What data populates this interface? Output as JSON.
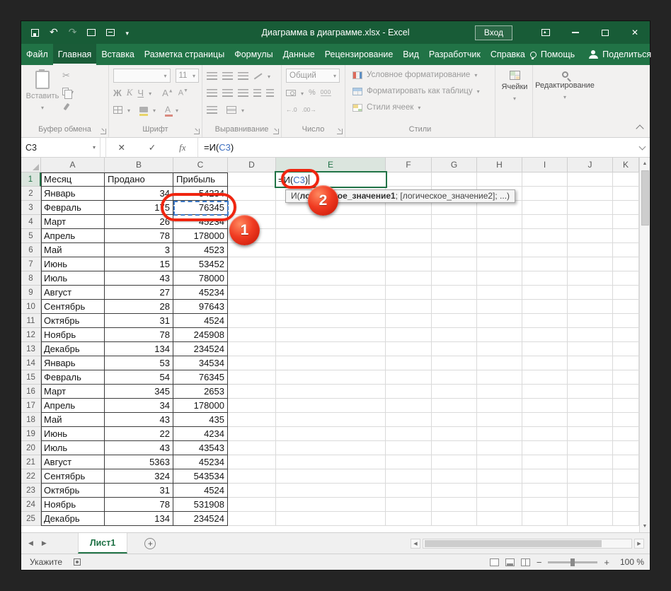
{
  "titlebar": {
    "title": "Диаграмма в диаграмме.xlsx - Excel",
    "signin": "Вход"
  },
  "tabs": {
    "items": [
      "Файл",
      "Главная",
      "Вставка",
      "Разметка страницы",
      "Формулы",
      "Данные",
      "Рецензирование",
      "Вид",
      "Разработчик",
      "Справка"
    ],
    "active": "Главная",
    "help": "Помощь",
    "share": "Поделиться"
  },
  "ribbon": {
    "clipboard": {
      "paste": "Вставить",
      "label": "Буфер обмена"
    },
    "font": {
      "size": "11",
      "bold": "Ж",
      "italic": "К",
      "underline": "Ч",
      "grow": "А",
      "shrink": "А",
      "color_letter": "А",
      "label": "Шрифт"
    },
    "alignment": {
      "label": "Выравнивание"
    },
    "number": {
      "format": "Общий",
      "percent": "%",
      "thousands": "000",
      "inc_dec": "←.0",
      "dec_dec": ".00→",
      "label": "Число"
    },
    "styles": {
      "items": [
        "Условное форматирование",
        "Форматировать как таблицу",
        "Стили ячеек"
      ],
      "label": "Стили"
    },
    "cells": {
      "label": "Ячейки"
    },
    "editing": {
      "label": "Редактирование"
    }
  },
  "formula_bar": {
    "name_box": "C3",
    "cancel": "✕",
    "enter": "✓",
    "fx": "fx",
    "formula": {
      "prefix": "=И(",
      "ref": "C3",
      "suffix": ")"
    }
  },
  "edit_cell": {
    "prefix": "=И(",
    "ref": "C3",
    "suffix": ")"
  },
  "tooltip": {
    "fn": "И(",
    "active_arg": "логическое_значение1",
    "rest": "; [логическое_значение2]; ...)"
  },
  "annotations": {
    "badge1": "1",
    "badge2": "2"
  },
  "grid": {
    "columns": [
      "A",
      "B",
      "C",
      "D",
      "E",
      "F",
      "G",
      "H",
      "I",
      "J",
      "K"
    ],
    "active_col": "E",
    "active_row": 1,
    "rows": [
      {
        "n": 1,
        "cells": [
          "Месяц",
          "Продано",
          "Прибыль"
        ]
      },
      {
        "n": 2,
        "cells": [
          "Январь",
          "34",
          "54234"
        ]
      },
      {
        "n": 3,
        "cells": [
          "Февраль",
          "175",
          "76345"
        ]
      },
      {
        "n": 4,
        "cells": [
          "Март",
          "26",
          "45234"
        ]
      },
      {
        "n": 5,
        "cells": [
          "Апрель",
          "78",
          "178000"
        ]
      },
      {
        "n": 6,
        "cells": [
          "Май",
          "3",
          "4523"
        ]
      },
      {
        "n": 7,
        "cells": [
          "Июнь",
          "15",
          "53452"
        ]
      },
      {
        "n": 8,
        "cells": [
          "Июль",
          "43",
          "78000"
        ]
      },
      {
        "n": 9,
        "cells": [
          "Август",
          "27",
          "45234"
        ]
      },
      {
        "n": 10,
        "cells": [
          "Сентябрь",
          "28",
          "97643"
        ]
      },
      {
        "n": 11,
        "cells": [
          "Октябрь",
          "31",
          "4524"
        ]
      },
      {
        "n": 12,
        "cells": [
          "Ноябрь",
          "78",
          "245908"
        ]
      },
      {
        "n": 13,
        "cells": [
          "Декабрь",
          "134",
          "234524"
        ]
      },
      {
        "n": 14,
        "cells": [
          "Январь",
          "53",
          "34534"
        ]
      },
      {
        "n": 15,
        "cells": [
          "Февраль",
          "54",
          "76345"
        ]
      },
      {
        "n": 16,
        "cells": [
          "Март",
          "345",
          "2653"
        ]
      },
      {
        "n": 17,
        "cells": [
          "Апрель",
          "34",
          "178000"
        ]
      },
      {
        "n": 18,
        "cells": [
          "Май",
          "43",
          "435"
        ]
      },
      {
        "n": 19,
        "cells": [
          "Июнь",
          "22",
          "4234"
        ]
      },
      {
        "n": 20,
        "cells": [
          "Июль",
          "43",
          "43543"
        ]
      },
      {
        "n": 21,
        "cells": [
          "Август",
          "5363",
          "45234"
        ]
      },
      {
        "n": 22,
        "cells": [
          "Сентябрь",
          "324",
          "543534"
        ]
      },
      {
        "n": 23,
        "cells": [
          "Октябрь",
          "31",
          "4524"
        ]
      },
      {
        "n": 24,
        "cells": [
          "Ноябрь",
          "78",
          "531908"
        ]
      },
      {
        "n": 25,
        "cells": [
          "Декабрь",
          "134",
          "234524"
        ]
      }
    ]
  },
  "sheet_bar": {
    "tab": "Лист1"
  },
  "status_bar": {
    "mode": "Укажите",
    "zoom": "100 %"
  }
}
